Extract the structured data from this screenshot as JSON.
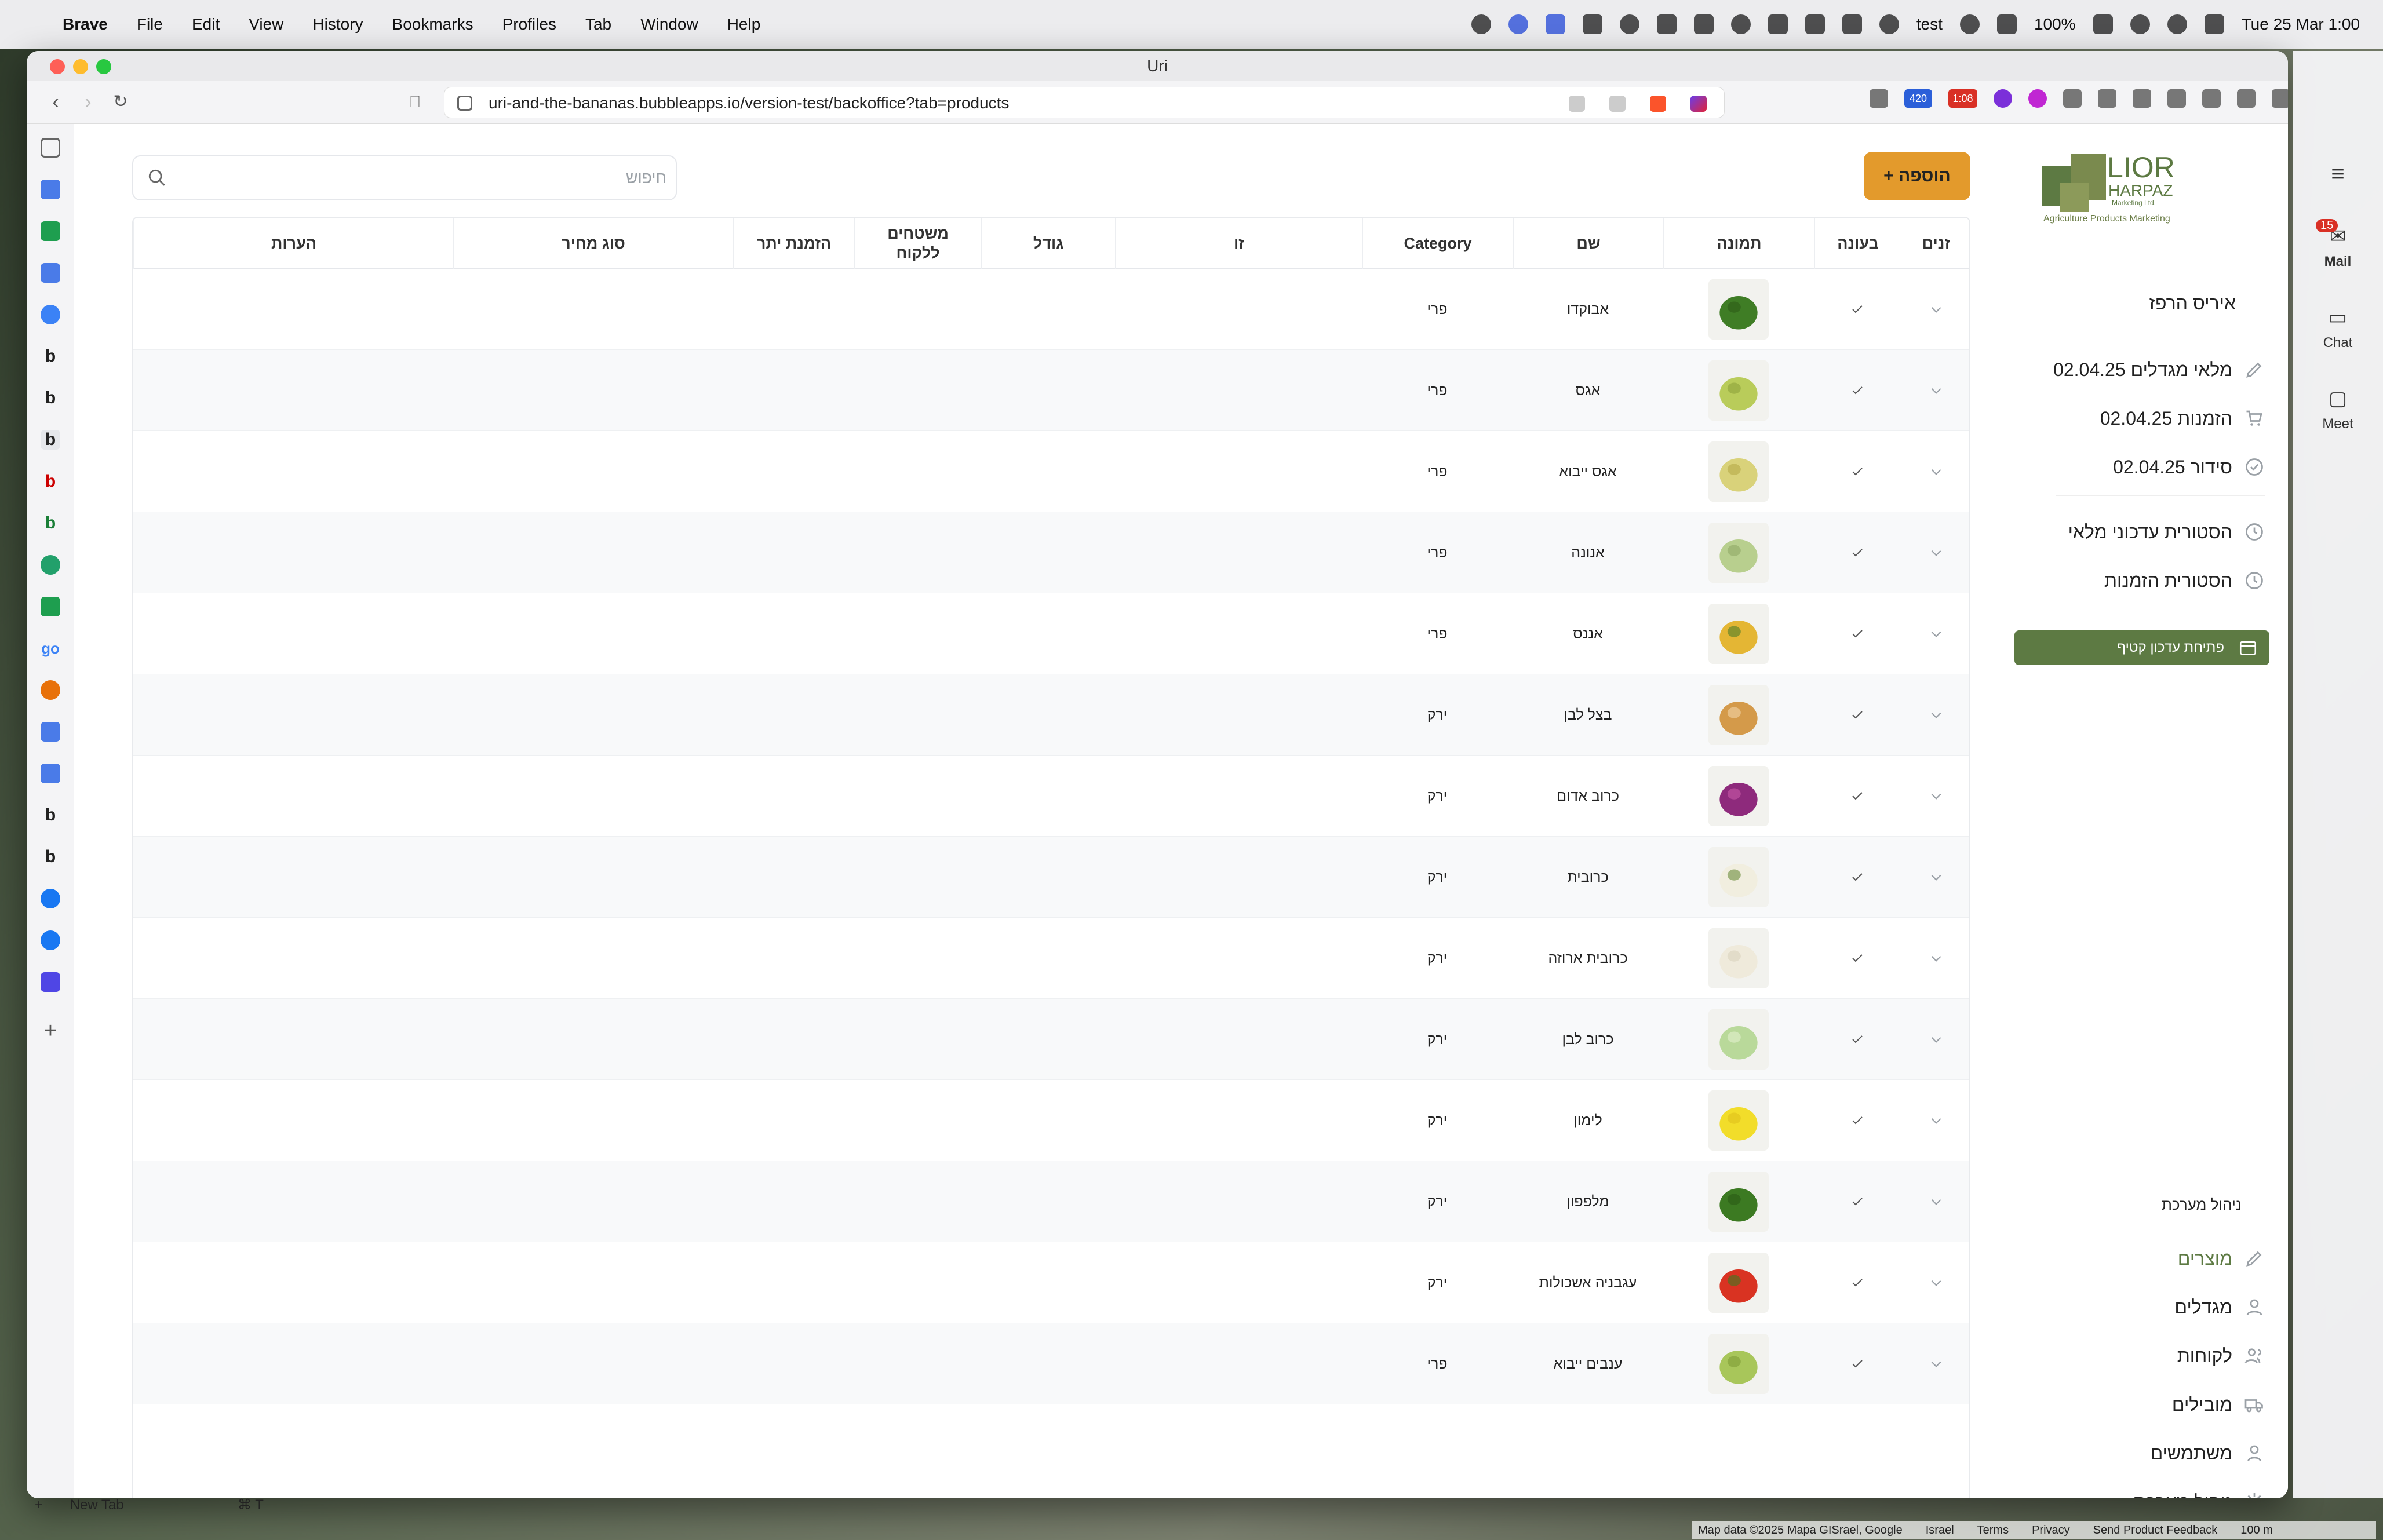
{
  "menubar": {
    "app": "Brave",
    "items": [
      "File",
      "Edit",
      "View",
      "History",
      "Bookmarks",
      "Profiles",
      "Tab",
      "Window",
      "Help"
    ],
    "user": "test",
    "battery": "100%",
    "datetime": "Tue 25 Mar  1:00"
  },
  "window": {
    "title": "Uri",
    "url": "uri-and-the-bananas.bubbleapps.io/version-test/backoffice?tab=products",
    "badges": {
      "count1": "420",
      "count2": "1:08"
    }
  },
  "page": {
    "search_placeholder": "חיפוש",
    "add_label": "הוספה",
    "columns": [
      "זנים",
      "בעונה",
      "תמונה",
      "שם",
      "Category",
      "זו",
      "גודל",
      "משטחים ללקוח",
      "הזמנת יתר",
      "סוג מחיר",
      "הערות"
    ],
    "rows": [
      {
        "name": "אבוקדו",
        "category": "פרי",
        "image": "avocado"
      },
      {
        "name": "אגס",
        "category": "פרי",
        "image": "pear"
      },
      {
        "name": "אגס ייבוא",
        "category": "פרי",
        "image": "pear-yellow"
      },
      {
        "name": "אנונה",
        "category": "פרי",
        "image": "annona"
      },
      {
        "name": "אננס",
        "category": "פרי",
        "image": "pineapple"
      },
      {
        "name": "בצל לבן",
        "category": "ירק",
        "image": "onion"
      },
      {
        "name": "כרוב אדום",
        "category": "ירק",
        "image": "red-cabbage"
      },
      {
        "name": "כרובית",
        "category": "ירק",
        "image": "cauliflower"
      },
      {
        "name": "כרובית ארוזה",
        "category": "ירק",
        "image": "packed-cauliflower"
      },
      {
        "name": "כרוב לבן",
        "category": "ירק",
        "image": "white-cabbage"
      },
      {
        "name": "לימון",
        "category": "ירק",
        "image": "lemon"
      },
      {
        "name": "מלפפון",
        "category": "ירק",
        "image": "cucumber"
      },
      {
        "name": "עגבניה אשכולות",
        "category": "ירק",
        "image": "tomato-vine"
      },
      {
        "name": "ענבים ייבוא",
        "category": "פרי",
        "image": "grapes"
      }
    ]
  },
  "sidebar": {
    "logo_main": "LIOR",
    "logo_sub": "HARPAZ",
    "logo_small": "Marketing Ltd.",
    "logo_tag": "Agriculture Products Marketing",
    "user_name": "איריס הרפז",
    "status_items": [
      {
        "label": "מלאי מגדלים 02.04.25",
        "icon": "pencil-icon"
      },
      {
        "label": "הזמנות 02.04.25",
        "icon": "cart-icon"
      },
      {
        "label": "סידור 02.04.25",
        "icon": "check-circle-icon"
      }
    ],
    "history_items": [
      {
        "label": "הסטורית עדכוני מלאי",
        "icon": "history-icon"
      },
      {
        "label": "הסטורית הזמנות",
        "icon": "history-icon"
      }
    ],
    "quick_button": "פתיחת עדכון קטיף",
    "system_title": "ניהול מערכת",
    "nav_items": [
      {
        "label": "מוצרים",
        "icon": "pencil-icon",
        "active": true
      },
      {
        "label": "מגדלים",
        "icon": "user-icon",
        "active": false
      },
      {
        "label": "לקוחות",
        "icon": "users-icon",
        "active": false
      },
      {
        "label": "מובילים",
        "icon": "truck-icon",
        "active": false
      },
      {
        "label": "משתמשים",
        "icon": "person-icon",
        "active": false
      },
      {
        "label": "ניהול מערכת",
        "icon": "gear-icon",
        "active": false
      }
    ]
  },
  "mailstrip": {
    "mail_badge": "15",
    "mail": "Mail",
    "chat": "Chat",
    "meet": "Meet"
  },
  "bottom": {
    "new_tab": "New Tab",
    "shortcut": "⌘  T",
    "map_credits": [
      "Map data ©2025 Mapa GISrael, Google",
      "Israel",
      "Terms",
      "Privacy",
      "Send Product Feedback",
      "100 m"
    ]
  },
  "colors": {
    "accent_orange": "#e39a2c",
    "accent_green": "#5d7a43",
    "nav_active": "#5d7a43"
  }
}
